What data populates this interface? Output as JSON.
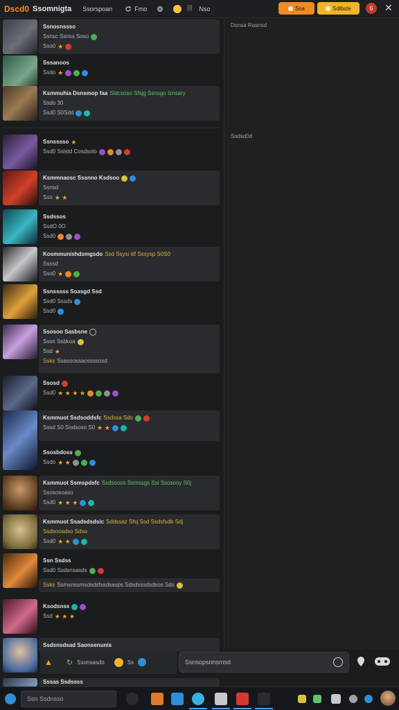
{
  "topbar": {
    "logo": "Dscd0",
    "app_name": "Ssomnigta",
    "nav_search": "Ssorspoan",
    "nav_item_2": "Fmo",
    "nav_item_3": "Nso",
    "btn_orange": "Ssa",
    "btn_gold": "Sdlbste",
    "notif_count": "6"
  },
  "feed": {
    "cards": [
      {
        "l1": "Ssnosnssso",
        "l2": "Ssnsc  Ssnss  Soso",
        "l3": "Sso0"
      },
      {
        "l1": "Sssanoos",
        "l2": "Ssdo"
      },
      {
        "l1": "Ksmmuhia Dsnsmop faa",
        "l1_tag": "Sldcsoso Sfsjg  Ssnsgo Iznsary",
        "l2": "Ssdo 30",
        "l3": "Ssd0  S0Sdd"
      },
      {
        "l1": "Ssnsssso",
        "l2": "Ssd0  Sslstd  Cosdsolo"
      },
      {
        "l1": "Ksmmnaosc Sssnno Ksdsoo",
        "l2": "Ssnsd",
        "l3": "Sso"
      },
      {
        "l1": "Ssdssos",
        "l2": "SsdO 0O",
        "l3": "Ssd0"
      },
      {
        "l1": "Kosmmunishdsmgsdo",
        "l1_tag": "Ssd Ssysi iiif Sssysp S0S0",
        "l2": "Ssssd",
        "l3": "Sso0"
      },
      {
        "l1": "Ssnsssss  Soasgd Ssd",
        "l2": "Ssd0  Sssds",
        "l3": "Ssd0"
      },
      {
        "l1": "Ssosoo Sasbsne",
        "l2": "Sssn Ssbkoa",
        "l3": "Ssd",
        "l4": "Ssks",
        "l4_tag": "Ssasoossaossssosd"
      },
      {
        "l1": "Ssosd",
        "l2": "Ssd0"
      },
      {
        "l1": "Ksmmuot Ssdsoddsfc",
        "l1_tag": "Ssdssa Sds",
        "l2": "Sssd  S0  Sodsoso  S0"
      },
      {
        "l1": "Ssosbdoss",
        "l2": "Ssdo"
      },
      {
        "l1": "Ksmmuot Ssmspdsfc",
        "l1_tag": "Ssdssoos Ssmssgs Ssi Ssosooy S0j",
        "l2": "Ssososoaso",
        "l3": "Ssd0"
      },
      {
        "l1": "Ksmmuot Ssadsdsdsic",
        "l1_tag": "Sddssaz Sfsj  Ssd Ssdsfsdb Sdj",
        "l2": "Ssdsoosdso Sdso",
        "l3": "Ssd0"
      },
      {
        "l1": "Ssn Ssdss",
        "l2": "Ssd0  Ssdsnsasds"
      },
      {
        "l1": "Ssks",
        "l1_tag": "Ssmsnssmsdsdsfssdsasps Sdsdsssdsdsos Sds"
      },
      {
        "l1": "Ksodsnss",
        "l2": "Ssd"
      },
      {
        "l1": "Ssdsnsdsad Saonsenunis"
      },
      {
        "l1": "Sssas Ssdssss"
      }
    ]
  },
  "rpanel": {
    "label_1": "Dsnsa Rasnsd",
    "label_2": "Ssdsd0d"
  },
  "composer": {
    "left_label": "Ssonsasdo",
    "left_label_2": "Ss",
    "input_placeholder": "Ssnsopsonsmsd"
  },
  "taskbar": {
    "search_placeholder": "Ssn Ssdnsso"
  }
}
